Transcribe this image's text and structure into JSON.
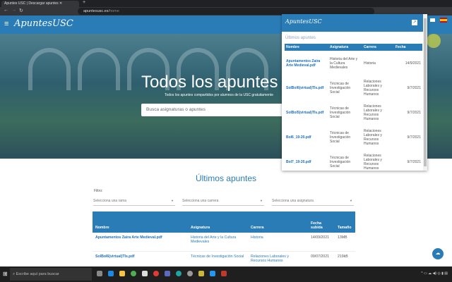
{
  "browser": {
    "tab_title": "Apuntes USC | Descargar apuntes",
    "url_host": "apuntesusc.es",
    "url_path": "/home",
    "new_tab": "+"
  },
  "nav": {
    "logo": "ApuntesUSC",
    "menu_icon": "≡"
  },
  "hero": {
    "title": "Todos los apuntes de la USC",
    "subtitle": "Todos los apuntes compartidos por alumnos de la USC gratuitamente",
    "search_placeholder": "Busca asignaturas o apuntes"
  },
  "main": {
    "title": "Últimos apuntes",
    "filter_label": "Filtro:",
    "filters": [
      "Selecciona una rama",
      "Selecciona una carrera",
      "Selecciona una asignatura"
    ],
    "columns": [
      "Nombre",
      "Asignatura",
      "Carrera",
      "Fecha subida",
      "Tamaño"
    ],
    "rows": [
      {
        "nombre": "Apuntamentos Zaira Arte Medieval.pdf",
        "asignatura": "Historia del Arte y la Cultura Medievales",
        "carrera": "Historia",
        "fecha": "14/09/2021",
        "tam": "13MB"
      },
      {
        "nombre": "SolBol6(virtual)TIs.pdf",
        "asignatura": "Técnicas de Investigación Social",
        "carrera": "Relaciones Laborales y Recursos Humanos",
        "fecha": "09/07/2021",
        "tam": "219kB"
      }
    ]
  },
  "popup": {
    "logo": "ApuntesUSC",
    "title": "Últimos apuntes",
    "columns": [
      "Nombre",
      "Asignatura",
      "Carrera",
      "Fecha"
    ],
    "rows": [
      {
        "nombre": "Apuntamentos Zaira Arte Medieval.pdf",
        "asignatura": "Historia del Arte y la Cultura Medievales",
        "carrera": "Historia",
        "fecha": "14/9/2021"
      },
      {
        "nombre": "SolBol6(virtual)TIs.pdf",
        "asignatura": "Técnicas de Investigación Social",
        "carrera": "Relaciones Laborales y Recursos Humanos",
        "fecha": "9/7/2021"
      },
      {
        "nombre": "SolBol5(virtual)TIs.pdf",
        "asignatura": "Técnicas de Investigación Social",
        "carrera": "Relaciones Laborales y Recursos Humanos",
        "fecha": "9/7/2021"
      },
      {
        "nombre": "Bol6_19-20.pdf",
        "asignatura": "Técnicas de Investigación Social",
        "carrera": "Relaciones Laborales y Recursos Humanos",
        "fecha": "9/7/2021"
      },
      {
        "nombre": "Bol7_19-20.pdf",
        "asignatura": "Técnicas de Investigación Social",
        "carrera": "Relaciones Laborales y Recursos Humanos",
        "fecha": "9/7/2021"
      }
    ]
  },
  "taskbar": {
    "search_placeholder": "Escribe aquí para buscar"
  },
  "colors": {
    "brand": "#2a7cb6"
  }
}
